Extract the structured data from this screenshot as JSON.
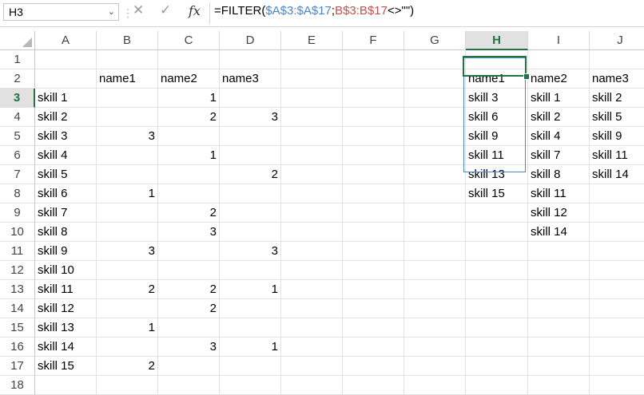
{
  "formula_bar": {
    "name_box": "H3",
    "fx_label": "fx",
    "formula_parts": [
      {
        "text": "=FILTER(",
        "color": "default"
      },
      {
        "text": "$A$3:$A$17",
        "color": "blue"
      },
      {
        "text": ";",
        "color": "default"
      },
      {
        "text": "B$3:B$17",
        "color": "red"
      },
      {
        "text": "<>\"\")",
        "color": "default"
      }
    ]
  },
  "selection": {
    "cell": "H3",
    "column": "H",
    "row": "3",
    "accent": "#217346",
    "spill_border": "#4a86c8"
  },
  "columns": [
    "A",
    "B",
    "C",
    "D",
    "E",
    "F",
    "G",
    "H",
    "I",
    "J"
  ],
  "rows": [
    "1",
    "2",
    "3",
    "4",
    "5",
    "6",
    "7",
    "8",
    "9",
    "10",
    "11",
    "12",
    "13",
    "14",
    "15",
    "16",
    "17",
    "18"
  ],
  "cells": [
    {
      "r": 2,
      "c": "B",
      "v": "name1"
    },
    {
      "r": 2,
      "c": "C",
      "v": "name2"
    },
    {
      "r": 2,
      "c": "D",
      "v": "name3"
    },
    {
      "r": 2,
      "c": "H",
      "v": "name1"
    },
    {
      "r": 2,
      "c": "I",
      "v": "name2"
    },
    {
      "r": 2,
      "c": "J",
      "v": "name3"
    },
    {
      "r": 3,
      "c": "A",
      "v": "skill 1"
    },
    {
      "r": 3,
      "c": "C",
      "v": "1",
      "num": true
    },
    {
      "r": 3,
      "c": "H",
      "v": "skill 3"
    },
    {
      "r": 3,
      "c": "I",
      "v": "skill 1"
    },
    {
      "r": 3,
      "c": "J",
      "v": "skill 2"
    },
    {
      "r": 4,
      "c": "A",
      "v": "skill 2"
    },
    {
      "r": 4,
      "c": "C",
      "v": "2",
      "num": true
    },
    {
      "r": 4,
      "c": "D",
      "v": "3",
      "num": true
    },
    {
      "r": 4,
      "c": "H",
      "v": "skill 6"
    },
    {
      "r": 4,
      "c": "I",
      "v": "skill 2"
    },
    {
      "r": 4,
      "c": "J",
      "v": "skill 5"
    },
    {
      "r": 5,
      "c": "A",
      "v": "skill 3"
    },
    {
      "r": 5,
      "c": "B",
      "v": "3",
      "num": true
    },
    {
      "r": 5,
      "c": "H",
      "v": "skill 9"
    },
    {
      "r": 5,
      "c": "I",
      "v": "skill 4"
    },
    {
      "r": 5,
      "c": "J",
      "v": "skill 9"
    },
    {
      "r": 6,
      "c": "A",
      "v": "skill 4"
    },
    {
      "r": 6,
      "c": "C",
      "v": "1",
      "num": true
    },
    {
      "r": 6,
      "c": "H",
      "v": "skill 11"
    },
    {
      "r": 6,
      "c": "I",
      "v": "skill 7"
    },
    {
      "r": 6,
      "c": "J",
      "v": "skill 11"
    },
    {
      "r": 7,
      "c": "A",
      "v": "skill 5"
    },
    {
      "r": 7,
      "c": "D",
      "v": "2",
      "num": true
    },
    {
      "r": 7,
      "c": "H",
      "v": "skill 13"
    },
    {
      "r": 7,
      "c": "I",
      "v": "skill 8"
    },
    {
      "r": 7,
      "c": "J",
      "v": "skill 14"
    },
    {
      "r": 8,
      "c": "A",
      "v": "skill 6"
    },
    {
      "r": 8,
      "c": "B",
      "v": "1",
      "num": true
    },
    {
      "r": 8,
      "c": "H",
      "v": "skill 15"
    },
    {
      "r": 8,
      "c": "I",
      "v": "skill 11"
    },
    {
      "r": 9,
      "c": "A",
      "v": "skill 7"
    },
    {
      "r": 9,
      "c": "C",
      "v": "2",
      "num": true
    },
    {
      "r": 9,
      "c": "I",
      "v": "skill 12"
    },
    {
      "r": 10,
      "c": "A",
      "v": "skill 8"
    },
    {
      "r": 10,
      "c": "C",
      "v": "3",
      "num": true
    },
    {
      "r": 10,
      "c": "I",
      "v": "skill 14"
    },
    {
      "r": 11,
      "c": "A",
      "v": "skill 9"
    },
    {
      "r": 11,
      "c": "B",
      "v": "3",
      "num": true
    },
    {
      "r": 11,
      "c": "D",
      "v": "3",
      "num": true
    },
    {
      "r": 12,
      "c": "A",
      "v": "skill 10"
    },
    {
      "r": 13,
      "c": "A",
      "v": "skill 11"
    },
    {
      "r": 13,
      "c": "B",
      "v": "2",
      "num": true
    },
    {
      "r": 13,
      "c": "C",
      "v": "2",
      "num": true
    },
    {
      "r": 13,
      "c": "D",
      "v": "1",
      "num": true
    },
    {
      "r": 14,
      "c": "A",
      "v": "skill 12"
    },
    {
      "r": 14,
      "c": "C",
      "v": "2",
      "num": true
    },
    {
      "r": 15,
      "c": "A",
      "v": "skill 13"
    },
    {
      "r": 15,
      "c": "B",
      "v": "1",
      "num": true
    },
    {
      "r": 16,
      "c": "A",
      "v": "skill 14"
    },
    {
      "r": 16,
      "c": "C",
      "v": "3",
      "num": true
    },
    {
      "r": 16,
      "c": "D",
      "v": "1",
      "num": true
    },
    {
      "r": 17,
      "c": "A",
      "v": "skill 15"
    },
    {
      "r": 17,
      "c": "B",
      "v": "2",
      "num": true
    }
  ]
}
